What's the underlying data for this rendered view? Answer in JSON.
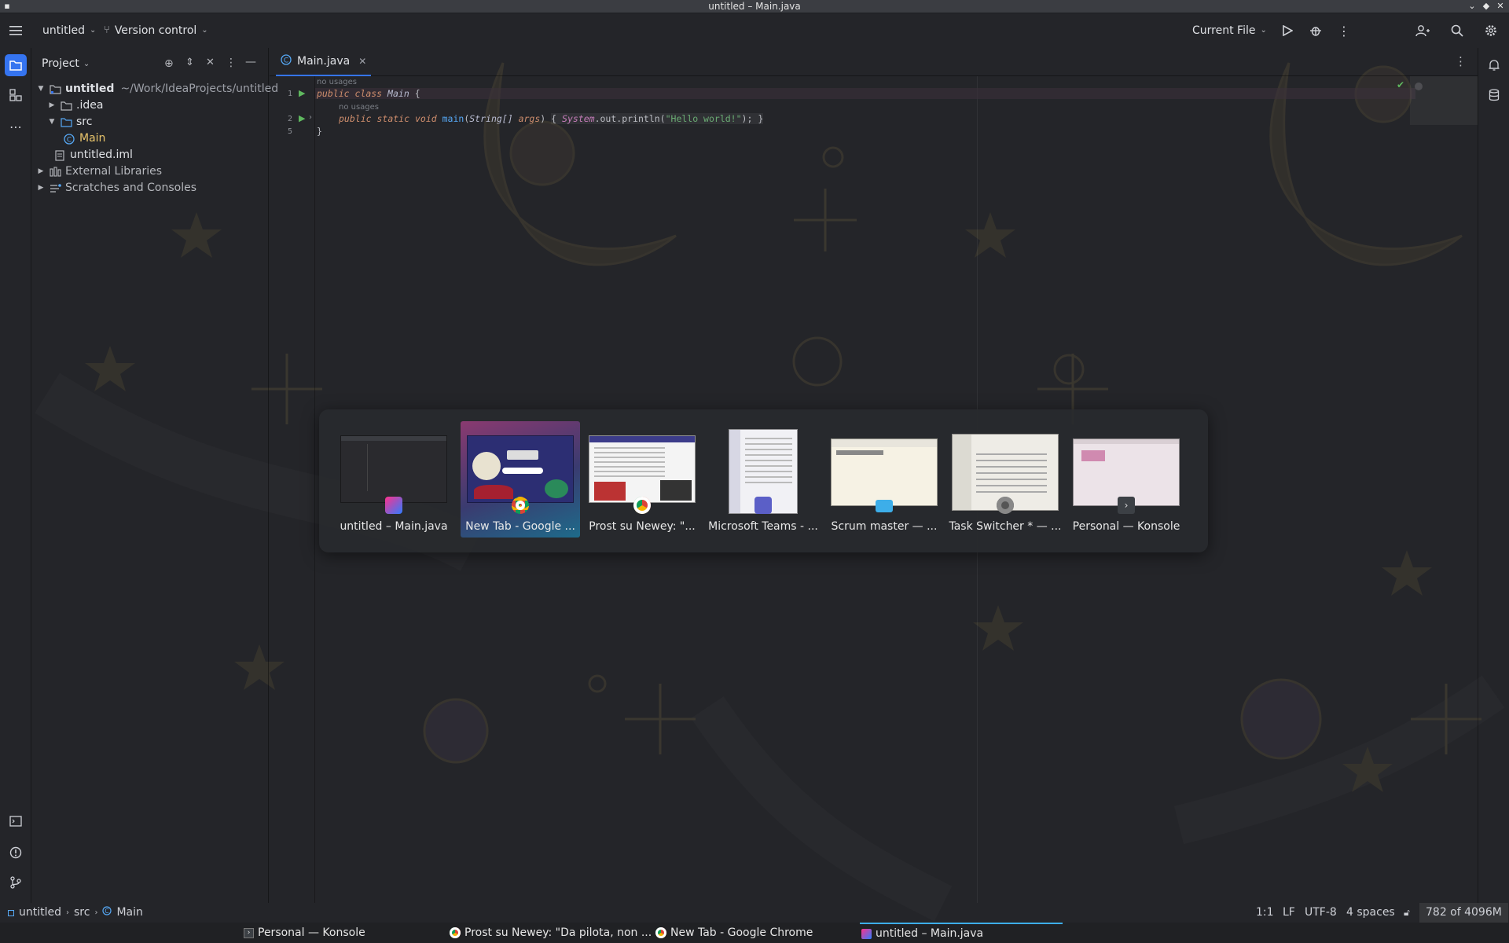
{
  "window": {
    "title": "untitled – Main.java"
  },
  "toolbar": {
    "project_name": "untitled",
    "vcs_label": "Version control",
    "run_config": "Current File"
  },
  "project_panel": {
    "title": "Project",
    "tree": [
      {
        "label": "untitled",
        "path": "~/Work/IdeaProjects/untitled"
      },
      {
        "label": ".idea"
      },
      {
        "label": "src"
      },
      {
        "label": "Main"
      },
      {
        "label": "untitled.iml"
      },
      {
        "label": "External Libraries"
      },
      {
        "label": "Scratches and Consoles"
      }
    ]
  },
  "editor": {
    "tab_label": "Main.java",
    "hint_usages": "no usages",
    "line_numbers": [
      "1",
      "2",
      "5"
    ],
    "code": {
      "l1_kw1": "public",
      "l1_kw2": "class",
      "l1_name": "Main",
      "l1_brace": "{",
      "l2_kw1": "public",
      "l2_kw2": "static",
      "l2_kw3": "void",
      "l2_fn": "main",
      "l2_paren1": "(",
      "l2_type": "String[]",
      "l2_arg": "args",
      "l2_paren2": ")",
      "l2_open": "{",
      "l2_sys": "System",
      "l2_out": ".out.println(",
      "l2_str": "\"Hello world!\"",
      "l2_end": ");",
      "l2_close": "}",
      "l3_brace": "}"
    }
  },
  "task_switcher": {
    "windows": [
      {
        "label": "untitled – Main.java",
        "icon": "intellij-icon"
      },
      {
        "label": "New Tab - Google ...",
        "icon": "chrome-icon",
        "selected": true
      },
      {
        "label": "Prost su Newey: \"...",
        "icon": "chrome-icon"
      },
      {
        "label": "Microsoft Teams - ...",
        "icon": "teams-icon"
      },
      {
        "label": "Scrum master — ...",
        "icon": "folder-icon"
      },
      {
        "label": "Task Switcher * — ...",
        "icon": "app-icon"
      },
      {
        "label": "Personal — Konsole",
        "icon": "terminal-icon"
      }
    ]
  },
  "statusbar": {
    "breadcrumb": [
      "untitled",
      "src",
      "Main"
    ],
    "position": "1:1",
    "line_sep": "LF",
    "encoding": "UTF-8",
    "indent": "4 spaces",
    "memory": "782 of 4096M"
  },
  "taskbar": {
    "tasks": [
      {
        "label": "Personal — Konsole",
        "icon": "terminal-icon"
      },
      {
        "label": "Prost su Newey: \"Da pilota, non ...",
        "icon": "chrome-icon"
      },
      {
        "label": "New Tab - Google Chrome",
        "icon": "chrome-icon"
      },
      {
        "label": "untitled – Main.java",
        "icon": "intellij-icon",
        "active": true
      }
    ]
  },
  "colors": {
    "accent": "#3574f0",
    "selection": "#3daee9",
    "background": "#242529"
  }
}
